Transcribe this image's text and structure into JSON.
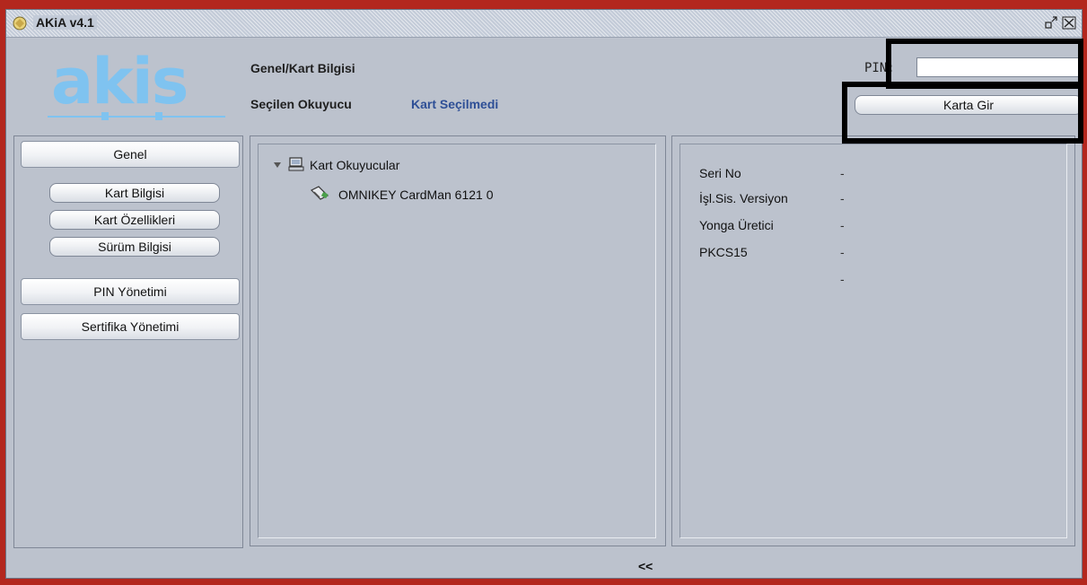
{
  "window": {
    "title": "AKiA v4.1"
  },
  "header": {
    "logo_text": "akis",
    "title": "Genel/Kart Bilgisi",
    "reader_label": "Seçilen Okuyucu",
    "reader_value": "Kart Seçilmedi",
    "pin_label": "PIN:",
    "pin_value": "",
    "login_button": "Karta Gir"
  },
  "sidebar": {
    "sections": [
      {
        "label": "Genel"
      },
      {
        "label": "PIN Yönetimi"
      },
      {
        "label": "Sertifika Yönetimi"
      }
    ],
    "sub_items": [
      {
        "label": "Kart Bilgisi"
      },
      {
        "label": "Kart Özellikleri"
      },
      {
        "label": "Sürüm Bilgisi"
      }
    ]
  },
  "tree": {
    "root": {
      "label": "Kart Okuyucular",
      "icon": "computer-icon",
      "expanded": true
    },
    "children": [
      {
        "label": "OMNIKEY CardMan 6121 0",
        "icon": "card-reader-icon"
      }
    ]
  },
  "card_info": {
    "rows": [
      {
        "label": "Seri No",
        "value": "-"
      },
      {
        "label": "İşl.Sis. Versiyon",
        "value": "-"
      },
      {
        "label": "Yonga Üretici",
        "value": "-"
      },
      {
        "label": "PKCS15",
        "value": "-"
      },
      {
        "label": "",
        "value": "-"
      }
    ]
  },
  "footer": {
    "toggle_label": "<<"
  },
  "colors": {
    "accent": "#2e4f96",
    "logo": "#7fc3f0",
    "background": "#bcc2cd"
  }
}
